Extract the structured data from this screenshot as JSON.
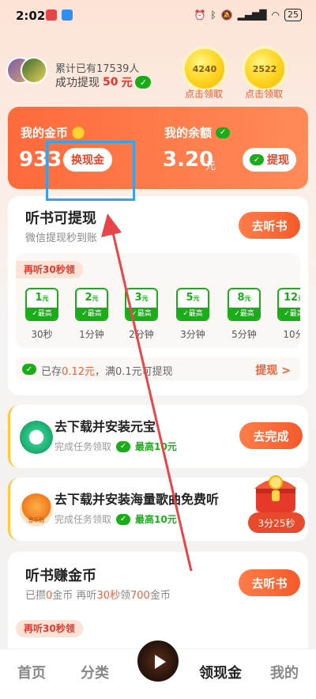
{
  "status_bar": {
    "time": "2:02",
    "battery": "25"
  },
  "header": {
    "cumulative_text": "累计已有17539人",
    "withdraw_prefix": "成功提现",
    "withdraw_amount": "50",
    "withdraw_unit": "元",
    "bubbles": [
      {
        "value": "4240",
        "caption": "点击领取"
      },
      {
        "value": "2522",
        "caption": "点击领取"
      }
    ]
  },
  "balance_card": {
    "coins_label": "我的金币",
    "coins_value": "933",
    "exchange_button": "换现金",
    "balance_label": "我的余额",
    "balance_value": "3.20",
    "balance_unit": "元",
    "withdraw_button": "提现"
  },
  "listen_card": {
    "title": "听书可提现",
    "subtitle": "微信提现秒到账",
    "button": "去听书",
    "tag": "再听30秒领",
    "tiers": [
      {
        "amount": "1",
        "unit": "元",
        "badge": "最高",
        "time": "30秒"
      },
      {
        "amount": "2",
        "unit": "元",
        "badge": "最高",
        "time": "1分钟"
      },
      {
        "amount": "3",
        "unit": "元",
        "badge": "最高",
        "time": "2分钟"
      },
      {
        "amount": "5",
        "unit": "元",
        "badge": "最高",
        "time": "3分钟"
      },
      {
        "amount": "8",
        "unit": "元",
        "badge": "最高",
        "time": "5分钟"
      },
      {
        "amount": "12",
        "unit": "元",
        "badge": "最高",
        "time": "10分"
      }
    ],
    "saved_prefix": "已存",
    "saved_amount": "0.12元",
    "saved_suffix": "，满0.1元可提现",
    "saved_link": "提现 >"
  },
  "tasks": [
    {
      "title": "去下载并安装元宝",
      "sub": "完成任务领取",
      "reward": "最高10元",
      "button": "去完成"
    },
    {
      "title": "去下载并安装海量歌曲免费听",
      "sub": "完成任务领取",
      "reward": "最高10元",
      "icon_label": "音乐版"
    }
  ],
  "chest_timer": "3分25秒",
  "earn_card": {
    "title": "听书赚金币",
    "sub_prefix": "已攒",
    "sub_coins": "0",
    "sub_mid": "金币 再听",
    "sub_time": "30秒",
    "sub_suffix": "领",
    "sub_reward": "700",
    "sub_end": "金币",
    "button": "去听书",
    "tag": "再听30秒领"
  },
  "tab_bar": {
    "tabs": [
      "首页",
      "分类",
      "领现金",
      "我的"
    ],
    "active": "领现金"
  },
  "colors": {
    "accent_orange": "#f55a2c",
    "wechat_green": "#1aad19",
    "highlight_blue": "#36a3e8",
    "arrow_red": "#e8454a"
  }
}
